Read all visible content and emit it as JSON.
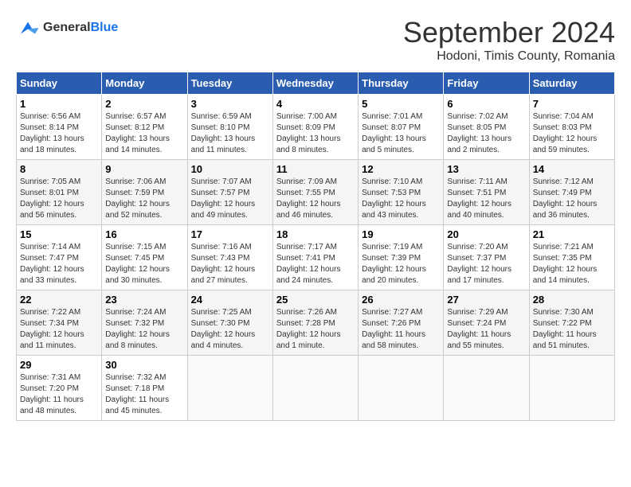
{
  "header": {
    "logo_text_general": "General",
    "logo_text_blue": "Blue",
    "month_title": "September 2024",
    "subtitle": "Hodoni, Timis County, Romania"
  },
  "calendar": {
    "days_of_week": [
      "Sunday",
      "Monday",
      "Tuesday",
      "Wednesday",
      "Thursday",
      "Friday",
      "Saturday"
    ],
    "weeks": [
      [
        {
          "day": "1",
          "info": "Sunrise: 6:56 AM\nSunset: 8:14 PM\nDaylight: 13 hours and 18 minutes."
        },
        {
          "day": "2",
          "info": "Sunrise: 6:57 AM\nSunset: 8:12 PM\nDaylight: 13 hours and 14 minutes."
        },
        {
          "day": "3",
          "info": "Sunrise: 6:59 AM\nSunset: 8:10 PM\nDaylight: 13 hours and 11 minutes."
        },
        {
          "day": "4",
          "info": "Sunrise: 7:00 AM\nSunset: 8:09 PM\nDaylight: 13 hours and 8 minutes."
        },
        {
          "day": "5",
          "info": "Sunrise: 7:01 AM\nSunset: 8:07 PM\nDaylight: 13 hours and 5 minutes."
        },
        {
          "day": "6",
          "info": "Sunrise: 7:02 AM\nSunset: 8:05 PM\nDaylight: 13 hours and 2 minutes."
        },
        {
          "day": "7",
          "info": "Sunrise: 7:04 AM\nSunset: 8:03 PM\nDaylight: 12 hours and 59 minutes."
        }
      ],
      [
        {
          "day": "8",
          "info": "Sunrise: 7:05 AM\nSunset: 8:01 PM\nDaylight: 12 hours and 56 minutes."
        },
        {
          "day": "9",
          "info": "Sunrise: 7:06 AM\nSunset: 7:59 PM\nDaylight: 12 hours and 52 minutes."
        },
        {
          "day": "10",
          "info": "Sunrise: 7:07 AM\nSunset: 7:57 PM\nDaylight: 12 hours and 49 minutes."
        },
        {
          "day": "11",
          "info": "Sunrise: 7:09 AM\nSunset: 7:55 PM\nDaylight: 12 hours and 46 minutes."
        },
        {
          "day": "12",
          "info": "Sunrise: 7:10 AM\nSunset: 7:53 PM\nDaylight: 12 hours and 43 minutes."
        },
        {
          "day": "13",
          "info": "Sunrise: 7:11 AM\nSunset: 7:51 PM\nDaylight: 12 hours and 40 minutes."
        },
        {
          "day": "14",
          "info": "Sunrise: 7:12 AM\nSunset: 7:49 PM\nDaylight: 12 hours and 36 minutes."
        }
      ],
      [
        {
          "day": "15",
          "info": "Sunrise: 7:14 AM\nSunset: 7:47 PM\nDaylight: 12 hours and 33 minutes."
        },
        {
          "day": "16",
          "info": "Sunrise: 7:15 AM\nSunset: 7:45 PM\nDaylight: 12 hours and 30 minutes."
        },
        {
          "day": "17",
          "info": "Sunrise: 7:16 AM\nSunset: 7:43 PM\nDaylight: 12 hours and 27 minutes."
        },
        {
          "day": "18",
          "info": "Sunrise: 7:17 AM\nSunset: 7:41 PM\nDaylight: 12 hours and 24 minutes."
        },
        {
          "day": "19",
          "info": "Sunrise: 7:19 AM\nSunset: 7:39 PM\nDaylight: 12 hours and 20 minutes."
        },
        {
          "day": "20",
          "info": "Sunrise: 7:20 AM\nSunset: 7:37 PM\nDaylight: 12 hours and 17 minutes."
        },
        {
          "day": "21",
          "info": "Sunrise: 7:21 AM\nSunset: 7:35 PM\nDaylight: 12 hours and 14 minutes."
        }
      ],
      [
        {
          "day": "22",
          "info": "Sunrise: 7:22 AM\nSunset: 7:34 PM\nDaylight: 12 hours and 11 minutes."
        },
        {
          "day": "23",
          "info": "Sunrise: 7:24 AM\nSunset: 7:32 PM\nDaylight: 12 hours and 8 minutes."
        },
        {
          "day": "24",
          "info": "Sunrise: 7:25 AM\nSunset: 7:30 PM\nDaylight: 12 hours and 4 minutes."
        },
        {
          "day": "25",
          "info": "Sunrise: 7:26 AM\nSunset: 7:28 PM\nDaylight: 12 hours and 1 minute."
        },
        {
          "day": "26",
          "info": "Sunrise: 7:27 AM\nSunset: 7:26 PM\nDaylight: 11 hours and 58 minutes."
        },
        {
          "day": "27",
          "info": "Sunrise: 7:29 AM\nSunset: 7:24 PM\nDaylight: 11 hours and 55 minutes."
        },
        {
          "day": "28",
          "info": "Sunrise: 7:30 AM\nSunset: 7:22 PM\nDaylight: 11 hours and 51 minutes."
        }
      ],
      [
        {
          "day": "29",
          "info": "Sunrise: 7:31 AM\nSunset: 7:20 PM\nDaylight: 11 hours and 48 minutes."
        },
        {
          "day": "30",
          "info": "Sunrise: 7:32 AM\nSunset: 7:18 PM\nDaylight: 11 hours and 45 minutes."
        },
        {
          "day": "",
          "info": ""
        },
        {
          "day": "",
          "info": ""
        },
        {
          "day": "",
          "info": ""
        },
        {
          "day": "",
          "info": ""
        },
        {
          "day": "",
          "info": ""
        }
      ]
    ]
  }
}
